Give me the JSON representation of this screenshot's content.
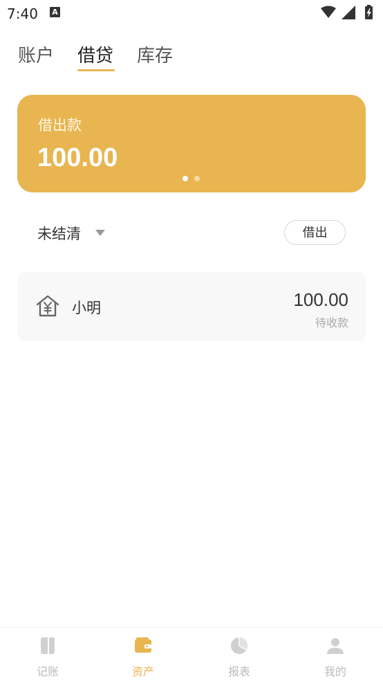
{
  "status_bar": {
    "time": "7:40",
    "notification_letter": "A",
    "icons": [
      "wifi-icon",
      "signal-icon",
      "battery-charging-icon"
    ]
  },
  "tabs": [
    {
      "label": "账户",
      "active": false
    },
    {
      "label": "借贷",
      "active": true
    },
    {
      "label": "库存",
      "active": false
    }
  ],
  "card": {
    "label": "借出款",
    "amount": "100.00",
    "page_count": 2,
    "active_page": 1
  },
  "filter": {
    "selected": "未结清",
    "icon": "caret-down-icon"
  },
  "lend_button": "借出",
  "records": [
    {
      "icon": "house-yuan-icon",
      "name": "小明",
      "amount": "100.00",
      "status": "待收款"
    }
  ],
  "bottom_nav": [
    {
      "label": "记账",
      "icon": "book-icon",
      "active": false
    },
    {
      "label": "资产",
      "icon": "wallet-icon",
      "active": true
    },
    {
      "label": "报表",
      "icon": "pie-chart-icon",
      "active": false
    },
    {
      "label": "我的",
      "icon": "user-icon",
      "active": false
    }
  ],
  "colors": {
    "accent": "#e8b550",
    "inactive_nav": "#bbbbbb",
    "text": "#333333",
    "muted": "#aaaaaa"
  }
}
